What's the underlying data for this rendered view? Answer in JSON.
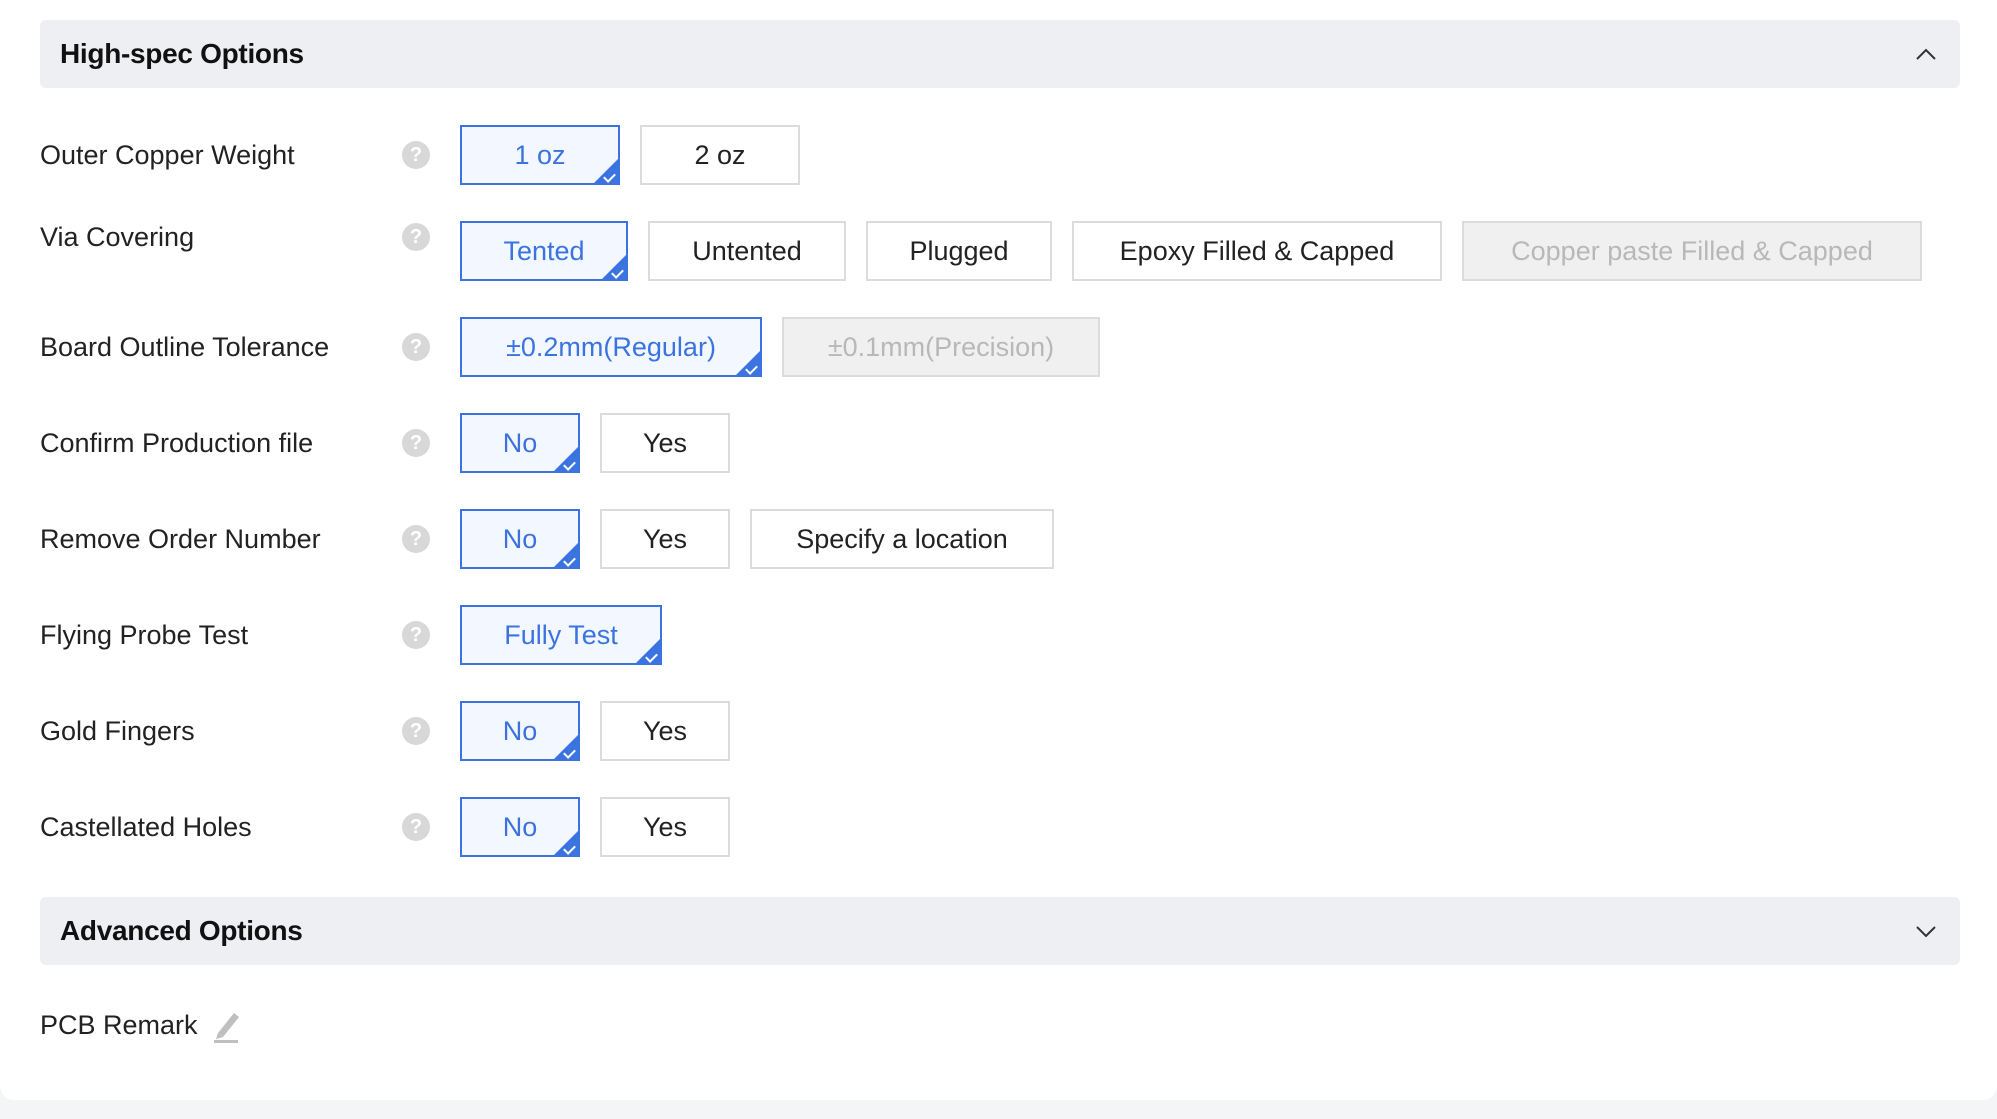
{
  "high_spec": {
    "title": "High-spec Options",
    "rows": [
      {
        "label": "Outer Copper Weight",
        "options": [
          "1 oz",
          "2 oz"
        ],
        "selected": 0
      },
      {
        "label": "Via Covering",
        "options": [
          "Tented",
          "Untented",
          "Plugged",
          "Epoxy Filled & Capped",
          "Copper paste Filled & Capped"
        ],
        "selected": 0,
        "disabled": [
          4
        ]
      },
      {
        "label": "Board Outline Tolerance",
        "options": [
          "±0.2mm(Regular)",
          "±0.1mm(Precision)"
        ],
        "selected": 0,
        "disabled": [
          1
        ]
      },
      {
        "label": "Confirm Production file",
        "options": [
          "No",
          "Yes"
        ],
        "selected": 0
      },
      {
        "label": "Remove Order Number",
        "options": [
          "No",
          "Yes",
          "Specify a location"
        ],
        "selected": 0
      },
      {
        "label": "Flying Probe Test",
        "options": [
          "Fully Test"
        ],
        "selected": 0
      },
      {
        "label": "Gold Fingers",
        "options": [
          "No",
          "Yes"
        ],
        "selected": 0
      },
      {
        "label": "Castellated Holes",
        "options": [
          "No",
          "Yes"
        ],
        "selected": 0
      }
    ]
  },
  "advanced": {
    "title": "Advanced Options"
  },
  "pcb_remark": {
    "label": "PCB Remark"
  },
  "help_glyph": "?",
  "colors": {
    "accent": "#3b73e0",
    "header_bg": "#eeeff3",
    "disabled_bg": "#f0f0f0",
    "disabled_text": "#b8b8b8"
  }
}
